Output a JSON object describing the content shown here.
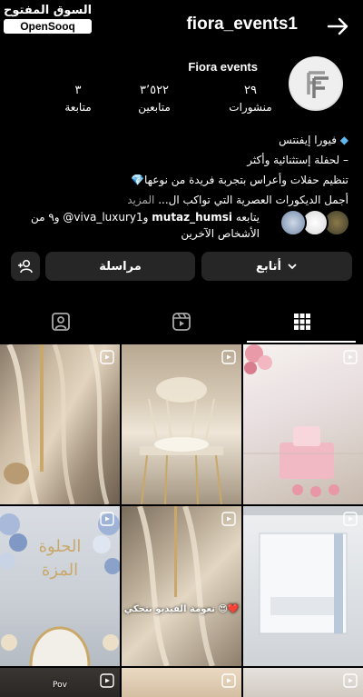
{
  "watermark": {
    "arabic": "السوق المفتوح",
    "brand": "OpenSooq"
  },
  "header": {
    "username": "fiora_events1"
  },
  "profile": {
    "display_name": "Fiora events",
    "avatar_logo": "FE",
    "stats": [
      {
        "value": "٢٩",
        "label": "منشورات"
      },
      {
        "value": "٣٬٥٢٢",
        "label": "متابعين"
      },
      {
        "value": "٣",
        "label": "متابعة"
      }
    ]
  },
  "bio": {
    "line1": "فيورا إيفنتس",
    "line2": "– لحفلة إستثنائية وأكثر",
    "line3": "تنظيم حفلات وأعراس بتجربة فريدة من نوعها",
    "line4": "أجمل الديكورات العصرية التي تواكب ال...",
    "more": "المزيد"
  },
  "followed_by": {
    "prefix": "يتابعه",
    "user1": "mutaz_humsi",
    "and": "و",
    "user2": "viva_luxury1@",
    "rest": "و٩ من الأشخاص الآخرين"
  },
  "buttons": {
    "follow": "أتابع",
    "message": "مراسلة"
  },
  "tabs": [
    "tagged",
    "reels",
    "grid"
  ],
  "grid": {
    "caption_cell5": "نعومة الفيديو بتحكي",
    "bottom_label": "Pov"
  },
  "colors": {
    "background": "#000000",
    "button": "#262626",
    "muted": "#a8a8a8"
  }
}
